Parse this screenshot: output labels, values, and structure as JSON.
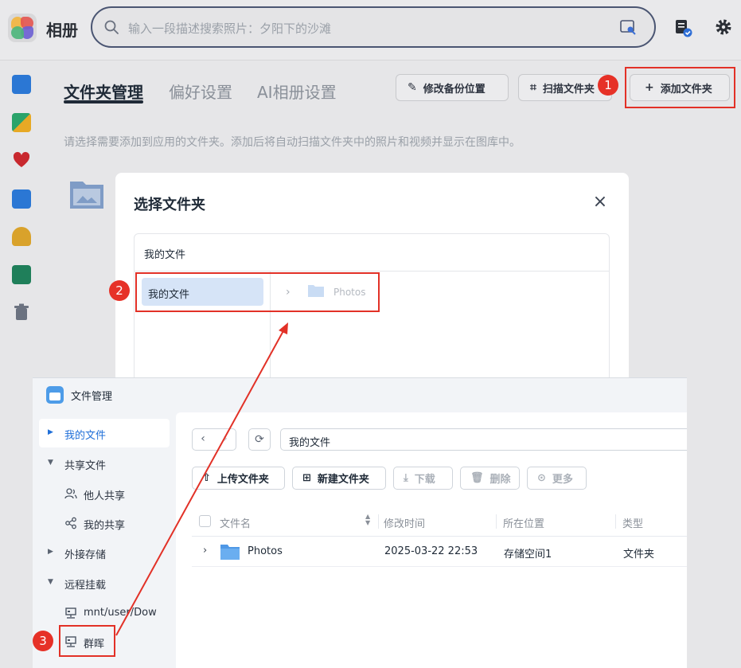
{
  "app": {
    "title": "相册",
    "search_placeholder": "输入一段描述搜索照片：夕阳下的沙滩",
    "tabs": [
      "文件夹管理",
      "偏好设置",
      "AI相册设置"
    ],
    "buttons": {
      "edit_backup": "修改备份位置",
      "scan": "扫描文件夹",
      "add_folder": "添加文件夹"
    },
    "description": "请选择需要添加到应用的文件夹。添加后将自动扫描文件夹中的照片和视频并显示在图库中。"
  },
  "dialog": {
    "title": "选择文件夹",
    "close": "×",
    "header_path": "我的文件",
    "selected_item": "我的文件",
    "child_folder": "Photos"
  },
  "annotations": [
    "1",
    "2",
    "3"
  ],
  "file_manager": {
    "title": "文件管理",
    "sidebar": {
      "my_files": "我的文件",
      "shared_files": "共享文件",
      "others_shared": "他人共享",
      "my_shared": "我的共享",
      "external_storage": "外接存储",
      "remote_mount": "远程挂载",
      "mount_1": "mnt/user/Downloads",
      "mount_2": "群晖"
    },
    "path": "我的文件",
    "actions": {
      "upload_folder": "上传文件夹",
      "new_folder": "新建文件夹",
      "download": "下载",
      "delete": "删除",
      "more": "更多"
    },
    "columns": [
      "文件名",
      "修改时间",
      "所在位置",
      "类型"
    ],
    "rows": [
      {
        "name": "Photos",
        "modified": "2025-03-22 22:53",
        "location": "存储空间1",
        "type": "文件夹"
      }
    ]
  },
  "colors": {
    "annotation_red": "#e23127",
    "accent_blue": "#1f6fd8",
    "selected_bg": "#d6e4f7"
  }
}
